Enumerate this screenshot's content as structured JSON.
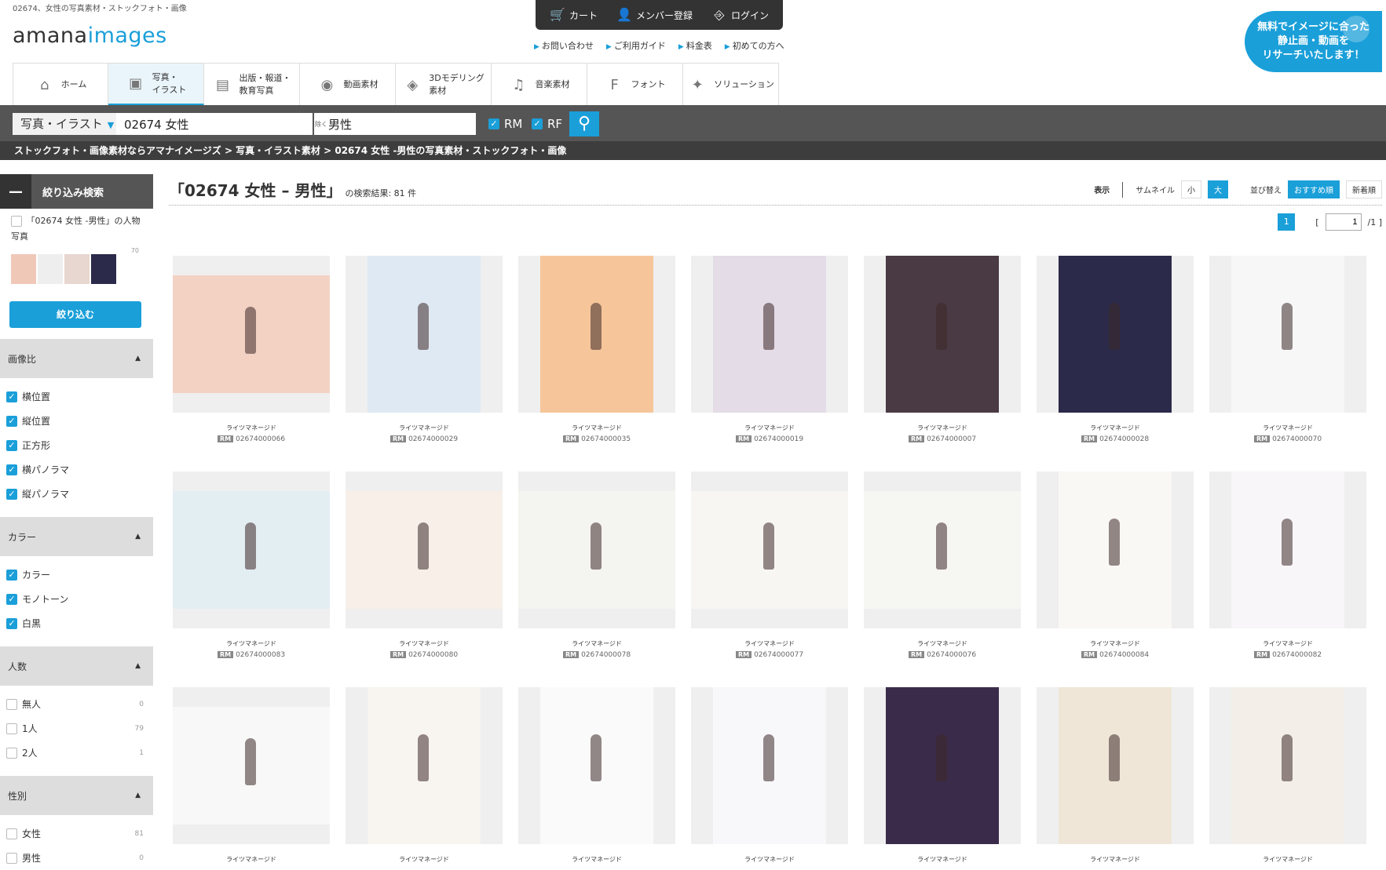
{
  "header": {
    "tagline": "02674、女性の写真素材・ストックフォト・画像",
    "logo_a": "amana",
    "logo_b": "images",
    "cart": "カート",
    "member": "メンバー登録",
    "login": "ログイン",
    "sublinks": [
      "お問い合わせ",
      "ご利用ガイド",
      "料金表",
      "初めての方へ"
    ],
    "bubble": [
      "無料でイメージに合った",
      "静止画・動画を",
      "リサーチいたします！"
    ]
  },
  "nav": [
    {
      "l1": "ホーム",
      "l2": "",
      "icon": "home-icon"
    },
    {
      "l1": "写真・",
      "l2": "イラスト",
      "icon": "photo-icon"
    },
    {
      "l1": "出版・報道・",
      "l2": "教育写真",
      "icon": "newspaper-icon"
    },
    {
      "l1": "動画素材",
      "l2": "",
      "icon": "video-camera-icon"
    },
    {
      "l1": "3Dモデリング",
      "l2": "素材",
      "icon": "cube-icon"
    },
    {
      "l1": "音楽素材",
      "l2": "",
      "icon": "music-note-icon"
    },
    {
      "l1": "フォント",
      "l2": "",
      "icon": "font-icon"
    },
    {
      "l1": "ソリューション",
      "l2": "",
      "icon": "lightbulb-icon"
    }
  ],
  "search": {
    "category": "写真・イラスト",
    "keyword": "02674 女性",
    "exclude_tag": "除く",
    "exclude": "男性",
    "rm": "RM",
    "rf": "RF"
  },
  "breadcrumb": "ストックフォト・画像素材ならアマナイメージズ > 写真・イラスト素材 > 02674 女性 -男性の写真素材・ストックフォト・画像",
  "sidebar": {
    "head": "絞り込み検索",
    "filter_label": "「02674 女性 -男性」の人物写真",
    "filter_count": "70",
    "narrow": "絞り込む",
    "sections": [
      {
        "title": "画像比",
        "options": [
          {
            "label": "横位置",
            "count": "",
            "checked": true
          },
          {
            "label": "縦位置",
            "count": "",
            "checked": true
          },
          {
            "label": "正方形",
            "count": "",
            "checked": true
          },
          {
            "label": "横パノラマ",
            "count": "",
            "checked": true
          },
          {
            "label": "縦パノラマ",
            "count": "",
            "checked": true
          }
        ]
      },
      {
        "title": "カラー",
        "options": [
          {
            "label": "カラー",
            "count": "",
            "checked": true
          },
          {
            "label": "モノトーン",
            "count": "",
            "checked": true
          },
          {
            "label": "白黒",
            "count": "",
            "checked": true
          }
        ]
      },
      {
        "title": "人数",
        "options": [
          {
            "label": "無人",
            "count": "0",
            "checked": false
          },
          {
            "label": "1人",
            "count": "79",
            "checked": false
          },
          {
            "label": "2人",
            "count": "1",
            "checked": false
          }
        ]
      },
      {
        "title": "性別",
        "options": [
          {
            "label": "女性",
            "count": "81",
            "checked": false
          },
          {
            "label": "男性",
            "count": "0",
            "checked": false
          }
        ]
      }
    ]
  },
  "results": {
    "title": "「02674 女性 – 男性」",
    "count_text": "の検索結果: 81 件",
    "display": "表示",
    "thumb": "サムネイル",
    "small": "小",
    "large": "大",
    "sort": "並び替え",
    "recommended": "おすすめ順",
    "newest": "新着順",
    "page": "1",
    "page_input": "1",
    "page_total": "/1 ]",
    "page_open": "[",
    "license": "ライツマネージド",
    "rm_badge": "RM",
    "items": [
      {
        "code": "02674000066",
        "bg": "#f3d2c4",
        "orient": "h"
      },
      {
        "code": "02674000029",
        "bg": "#dfe9f3",
        "orient": "v"
      },
      {
        "code": "02674000035",
        "bg": "#f6c69a",
        "orient": "v"
      },
      {
        "code": "02674000019",
        "bg": "#e4dce6",
        "orient": "v"
      },
      {
        "code": "02674000007",
        "bg": "#4a3a44",
        "orient": "v"
      },
      {
        "code": "02674000028",
        "bg": "#2b2a4a",
        "orient": "v"
      },
      {
        "code": "02674000070",
        "bg": "#f7f7f7",
        "orient": "v"
      },
      {
        "code": "02674000083",
        "bg": "#e3eef3",
        "orient": "h"
      },
      {
        "code": "02674000080",
        "bg": "#f7efe8",
        "orient": "h"
      },
      {
        "code": "02674000078",
        "bg": "#f4f4f0",
        "orient": "h"
      },
      {
        "code": "02674000077",
        "bg": "#f8f6f3",
        "orient": "h"
      },
      {
        "code": "02674000076",
        "bg": "#f6f6f3",
        "orient": "h"
      },
      {
        "code": "02674000084",
        "bg": "#faf8f5",
        "orient": "v"
      },
      {
        "code": "02674000082",
        "bg": "#f8f6f8",
        "orient": "v"
      },
      {
        "code": "",
        "bg": "#f8f8f8",
        "orient": "h"
      },
      {
        "code": "",
        "bg": "#f8f4ef",
        "orient": "v"
      },
      {
        "code": "",
        "bg": "#fafafa",
        "orient": "v"
      },
      {
        "code": "",
        "bg": "#f8f8fb",
        "orient": "v"
      },
      {
        "code": "",
        "bg": "#3b2b4a",
        "orient": "v"
      },
      {
        "code": "",
        "bg": "#efe6d8",
        "orient": "v"
      },
      {
        "code": "",
        "bg": "#f3efe8",
        "orient": "v"
      }
    ]
  },
  "colors": {
    "accent": "#1a9fd9",
    "dark": "#333333",
    "searchbar": "#555555"
  }
}
